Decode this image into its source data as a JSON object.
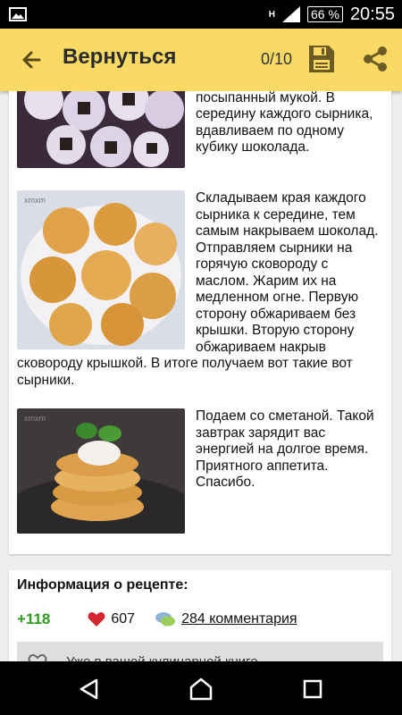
{
  "status_bar": {
    "battery": "66 %",
    "time": "20:55",
    "network": "H"
  },
  "app_bar": {
    "back_icon": "arrow-left-icon",
    "title": "Вернуться",
    "counter": "0/10",
    "save_icon": "floppy-disk-icon",
    "share_icon": "share-icon",
    "background": "#fad964"
  },
  "steps": [
    {
      "image": "syrniki-with-chocolate-photo",
      "text": "выкладываем их на стол посыпанный мукой. В середину каждого сырника, вдавливаем по одному кубику шоколада."
    },
    {
      "image": "fried-syrniki-photo",
      "image_caption": "xmxm",
      "text": "Складываем края каждого сырника к середине, тем самым накрываем шоколад. Отправляем сырники на горячую сковороду с маслом. Жарим их на медленном огне. Первую сторону обжариваем без крышки. Вторую сторону обжариваем накрыв сковороду крышкой. В итоге получаем вот такие вот сырники."
    },
    {
      "image": "syrniki-with-sour-cream-photo",
      "image_caption": "xmxm",
      "text": "Подаем со сметаной. Такой завтрак зарядит вас энергией на долгое время. Приятного аппетита. Спасибо."
    }
  ],
  "recipe_info": {
    "title": "Информация о рецепте:",
    "rating": "+118",
    "rating_color": "#2e9b1e",
    "likes": "607",
    "comments": "284 комментария",
    "cookbook_text": "Уже в вашей кулинарной книге"
  },
  "nav_bar": {
    "back_icon": "triangle-back-icon",
    "home_icon": "circle-home-icon",
    "recents_icon": "square-recents-icon"
  }
}
